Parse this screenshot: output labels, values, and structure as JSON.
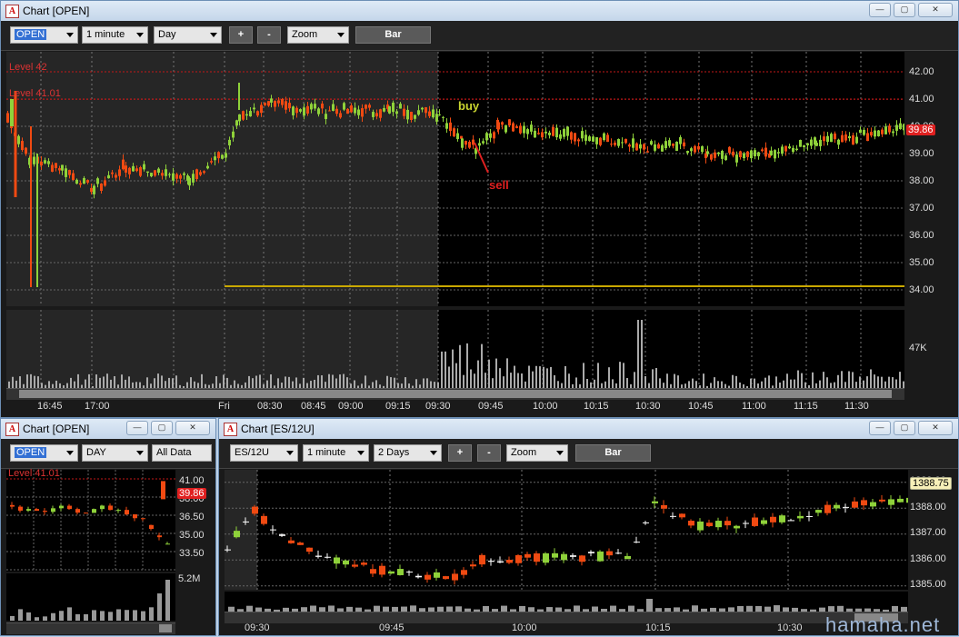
{
  "win1": {
    "title": "Chart [OPEN]",
    "symbol": "OPEN",
    "interval": "1 minute",
    "period": "Day",
    "zoom": "Zoom",
    "plus": "+",
    "minus": "-",
    "mode": "Bar",
    "levels": [
      {
        "label": "Level 42",
        "price": 42.0
      },
      {
        "label": "Level 41.01",
        "price": 41.01
      }
    ],
    "yticks": [
      "42.00",
      "41.00",
      "40.00",
      "39.00",
      "38.00",
      "37.00",
      "36.00",
      "35.00",
      "34.00"
    ],
    "last": "39.86",
    "volume_label": "47K",
    "xticks": [
      "16:45",
      "17:00",
      "Fri",
      "08:30",
      "08:45",
      "09:00",
      "09:15",
      "09:30",
      "09:45",
      "10:00",
      "10:15",
      "10:30",
      "10:45",
      "11:00",
      "11:15",
      "11:30"
    ],
    "buy": "buy",
    "sell": "sell"
  },
  "win2": {
    "title": "Chart [OPEN]",
    "symbol": "OPEN",
    "period": "DAY",
    "range": "All Data",
    "level": "Level 41.01",
    "yticks": [
      "41.00",
      "38.00",
      "36.50",
      "35.00",
      "33.50"
    ],
    "last": "39.86",
    "volume_label": "5.2M"
  },
  "win3": {
    "title": "Chart [ES/12U]",
    "symbol": "ES/12U",
    "interval": "1 minute",
    "period": "2 Days",
    "zoom": "Zoom",
    "plus": "+",
    "minus": "-",
    "mode": "Bar",
    "yticks": [
      "1389.00",
      "1388.00",
      "1387.00",
      "1386.00",
      "1385.00"
    ],
    "last": "1388.75",
    "xticks": [
      "09:30",
      "09:45",
      "10:00",
      "10:15",
      "10:30"
    ]
  },
  "watermark": "hamaha.net",
  "colors": {
    "up": "#8fd23a",
    "down": "#f04a12",
    "level": "#c21818",
    "gold": "#c9a800"
  }
}
